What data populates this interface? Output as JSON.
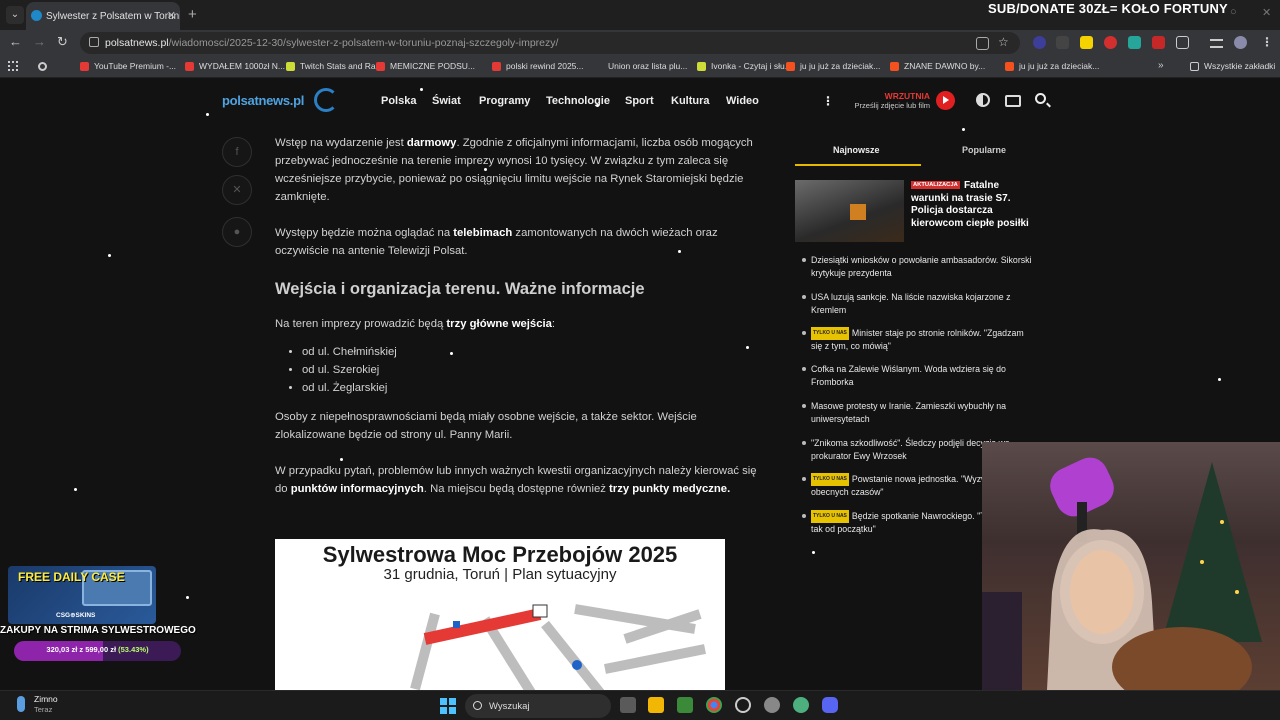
{
  "tab": {
    "title": "Sylwester z Polsatem w Toruniu. Poznaj szczegóły imprezy",
    "close": "✕",
    "new": "+"
  },
  "overlay_text": "SUB/DONATE 30ZŁ= KOŁO FORTUNY",
  "window": {
    "minimize": "○",
    "close": "✕"
  },
  "address": {
    "host": "polsatnews.pl",
    "path": "/wiadomosci/2025-12-30/sylwester-z-polsatem-w-toruniu-poznaj-szczegoly-imprezy/"
  },
  "bookmarks": [
    {
      "label": "YouTube Premium -...",
      "color": "#e53935"
    },
    {
      "label": "WYDAŁEM 1000zł N...",
      "color": "#e53935"
    },
    {
      "label": "Twitch Stats and Ra...",
      "color": "#cddc39"
    },
    {
      "label": "MEMICZNE PODSU...",
      "color": "#e53935"
    },
    {
      "label": "polski rewind 2025...",
      "color": "#e53935"
    },
    {
      "label": "Union oraz lista plu...",
      "color": "#35363a"
    },
    {
      "label": "Ivonka - Czytaj i słu...",
      "color": "#cddc39"
    },
    {
      "label": "ju ju już za dzieciak...",
      "color": "#f4511e"
    },
    {
      "label": "ZNANE DAWNO by...",
      "color": "#f4511e"
    },
    {
      "label": "ju ju już za dzieciak...",
      "color": "#f4511e"
    }
  ],
  "bookmarks_all": "Wszystkie zakładki",
  "header": {
    "logo": "polsatnews.pl",
    "nav": [
      "Polska",
      "Świat",
      "Programy",
      "Technologie",
      "Sport",
      "Kultura",
      "Wideo"
    ],
    "more": "⋮",
    "wrzutnia": "WRZUTNIA",
    "wrzutnia_sub": "Prześlij zdjęcie lub film"
  },
  "article": {
    "p1_a": "Wstęp na wydarzenie jest ",
    "p1_b": "darmowy",
    "p1_c": ". Zgodnie z oficjalnymi informacjami, liczba osób mogących przebywać jednocześnie na terenie imprezy wynosi 10 tysięcy. W związku z tym zaleca się  wcześniejsze przybycie, ponieważ po osiągnięciu limitu wejście na Rynek Staromiejski będzie zamknięte.",
    "p2_a": "Występy będzie można oglądać na ",
    "p2_b": "telebimach",
    "p2_c": " zamontowanych na dwóch wieżach oraz oczywiście na antenie Telewizji Polsat.",
    "h2": "Wejścia i organizacja terenu. Ważne informacje",
    "p3_a": "Na teren imprezy prowadzić będą ",
    "p3_b": "trzy główne wejścia",
    "p3_c": ":",
    "list": [
      "od ul. Chełmińskiej",
      "od ul. Szerokiej",
      "od ul. Żeglarskiej"
    ],
    "p4": "Osoby z niepełnosprawnościami będą miały osobne wejście, a także sektor. Wejście zlokalizowane będzie od strony ul. Panny Marii.",
    "p5_a": "W przypadku pytań, problemów lub innych ważnych kwestii organizacyjnych należy kierować się do ",
    "p5_b": "punktów informacyjnych",
    "p5_c": ". Na miejscu będą dostępne również ",
    "p5_d": "trzy punkty medyczne.",
    "map_title": "Sylwestrowa Moc Przebojów 2025",
    "map_sub": "31 grudnia, Toruń | Plan sytuacyjny"
  },
  "sidebar": {
    "tabs": [
      "Najnowsze",
      "Popularne"
    ],
    "lead_badge": "AKTUALIZACJA",
    "lead_title": "Fatalne warunki na trasie S7. Policja dostarcza kierowcom ciepłe posiłki",
    "items": [
      {
        "badge": "",
        "title": "Dziesiątki wniosków o powołanie ambasadorów. Sikorski krytykuje prezydenta"
      },
      {
        "badge": "",
        "title": "USA luzują sankcje. Na liście nazwiska kojarzone z Kremlem"
      },
      {
        "badge": "TYLKO U NAS",
        "title": "Minister staje po stronie rolników. \"Zgadzam się z tym, co mówią\""
      },
      {
        "badge": "",
        "title": "Cofka na Zalewie Wiślanym. Woda wdziera się do Fromborka"
      },
      {
        "badge": "",
        "title": "Masowe protesty w Iranie. Zamieszki wybuchły na uniwersytetach"
      },
      {
        "badge": "",
        "title": "\"Znikoma szkodliwość\". Śledczy podjęli decyzję ws. prokurator Ewy Wrzosek"
      },
      {
        "badge": "TYLKO U NAS",
        "title": "Powstanie nowa jednostka. \"Wyzwanie obecnych czasów\""
      },
      {
        "badge": "TYLKO U NAS",
        "title": "Będzie spotkanie Nawrockiego. \"Trzeba było tak od początku\""
      }
    ]
  },
  "promo": {
    "title": "FREE DAILY CASE",
    "brand": "CSG⊕SKINS",
    "zakupy": "ZAKUPY NA STRIMA SYLWESTROWEGO",
    "progress_pre": "320,03 zł z 599,00 zł ",
    "progress_pct": "(53.43%)",
    "progress_fraction": 0.5343
  },
  "taskbar": {
    "weather": "Zimno",
    "weather_sub": "Teraz",
    "search": "Wyszukaj"
  }
}
